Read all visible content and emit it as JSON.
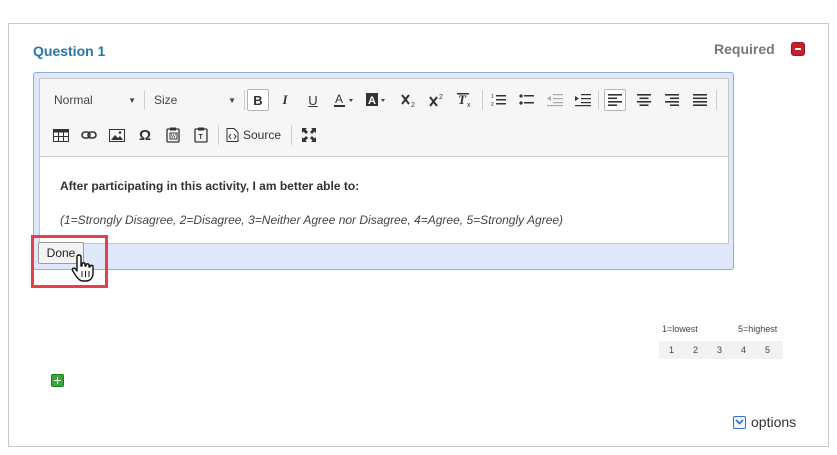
{
  "question": {
    "title": "Question 1",
    "required_label": "Required"
  },
  "toolbar": {
    "format_combo": "Normal",
    "size_combo": "Size",
    "source_label": "Source",
    "row1": [
      "bold-icon",
      "italic-icon",
      "underline-icon",
      "text-color-icon",
      "background-color-icon",
      "subscript-icon",
      "superscript-icon",
      "remove-format-icon",
      "numbered-list-icon",
      "bulleted-list-icon",
      "decrease-indent-icon",
      "increase-indent-icon",
      "align-left-icon",
      "align-center-icon",
      "align-right-icon",
      "justify-icon"
    ],
    "row2": [
      "table-icon",
      "link-icon",
      "image-icon",
      "special-char-icon",
      "paste-word-icon",
      "paste-text-icon",
      "source-icon",
      "maximize-icon"
    ]
  },
  "content": {
    "heading": "After participating in this activity, I am better able to:",
    "scale_text": "(1=Strongly Disagree, 2=Disagree, 3=Neither Agree nor Disagree, 4=Agree, 5=Strongly Agree)"
  },
  "done_label": "Done",
  "scale": {
    "low_label": "1=lowest",
    "high_label": "5=highest",
    "values": [
      "1",
      "2",
      "3",
      "4",
      "5"
    ]
  },
  "options_label": "options",
  "colors": {
    "title_blue": "#2777a6",
    "highlight_red": "#e3414a",
    "editor_frame": "#dfe7fb"
  }
}
